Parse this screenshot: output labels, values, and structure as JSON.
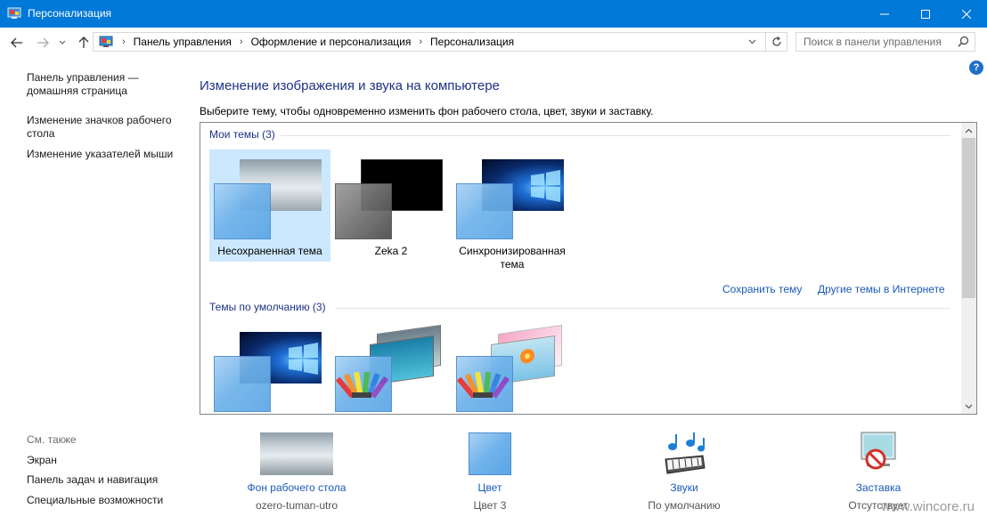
{
  "window": {
    "title": "Персонализация"
  },
  "address": {
    "crumbs": [
      "Панель управления",
      "Оформление и персонализация",
      "Персонализация"
    ]
  },
  "search": {
    "placeholder": "Поиск в панели управления"
  },
  "left_pane": {
    "links": [
      "Панель управления —",
      "домашняя страница",
      "Изменение значков рабочего",
      "стола",
      "Изменение указателей мыши"
    ],
    "see_also_title": "См. также",
    "see_also": [
      "Экран",
      "Панель задач и навигация",
      "Специальные возможности"
    ]
  },
  "main": {
    "heading": "Изменение изображения и звука на компьютере",
    "subtext": "Выберите тему, чтобы одновременно изменить фон рабочего стола, цвет, звуки и заставку.",
    "my_themes_title": "Мои темы (3)",
    "my_themes": [
      {
        "label": "Несохраненная тема",
        "selected": true
      },
      {
        "label": "Zeka 2",
        "selected": false
      },
      {
        "label": "Синхронизированная",
        "label2": "тема",
        "selected": false
      }
    ],
    "save_theme": "Сохранить тему",
    "more_themes": "Другие темы в Интернете",
    "default_themes_title": "Темы по умолчанию (3)"
  },
  "bottom": {
    "items": [
      {
        "label": "Фон рабочего стола",
        "value": "ozero-tuman-utro",
        "icon": "desktop-background-icon"
      },
      {
        "label": "Цвет",
        "value": "Цвет 3",
        "icon": "color-icon"
      },
      {
        "label": "Звуки",
        "value": "По умолчанию",
        "icon": "sounds-icon"
      },
      {
        "label": "Заставка",
        "value": "Отсутствует",
        "icon": "screensaver-icon"
      }
    ]
  },
  "watermark": "www.wincore.ru",
  "colors": {
    "titlebar": "#0078d7",
    "link": "#1a5ab5",
    "heading": "#1e3287",
    "selection": "#cce8ff"
  }
}
